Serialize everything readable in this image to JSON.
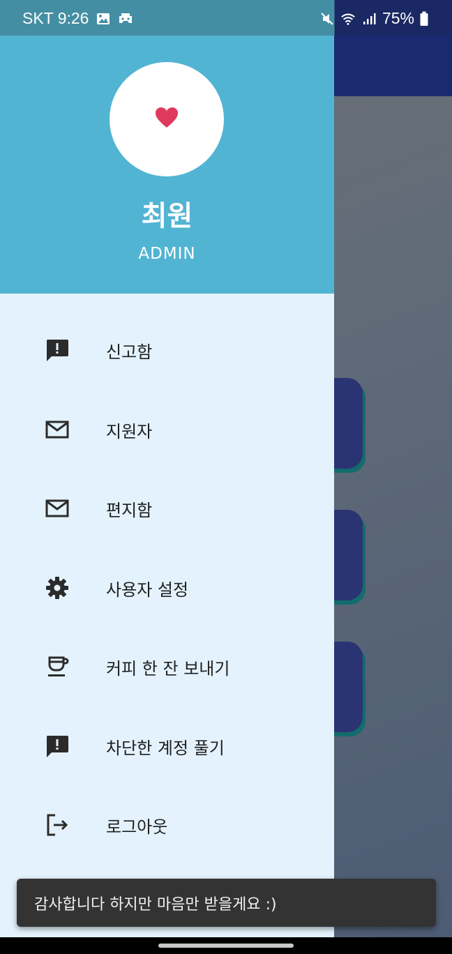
{
  "status_bar": {
    "carrier_time": "SKT 9:26",
    "left_icons": [
      "image-icon",
      "game-controller-icon"
    ],
    "right_icons": [
      "mute-icon",
      "wifi-icon",
      "signal-icon"
    ],
    "battery": "75%"
  },
  "drawer": {
    "header": {
      "avatar_icon": "heart-icon",
      "name": "최원",
      "role": "ADMIN"
    },
    "items": [
      {
        "label": "신고함",
        "icon": "report-icon"
      },
      {
        "label": "지원자",
        "icon": "mail-icon"
      },
      {
        "label": "편지함",
        "icon": "mail-icon"
      },
      {
        "label": "사용자 설정",
        "icon": "gear-icon"
      },
      {
        "label": "커피 한 잔 보내기",
        "icon": "coffee-icon"
      },
      {
        "label": "차단한 계정 풀기",
        "icon": "report-icon"
      },
      {
        "label": "로그아웃",
        "icon": "logout-icon"
      }
    ]
  },
  "snackbar": {
    "message": "감사합니다 하지만 마음만 받을게요 :)"
  },
  "colors": {
    "header": "#52b4d3",
    "drawer_bg": "#e3f2fc",
    "heart": "#e0395e",
    "app_bar": "#1b2a70",
    "snackbar_bg": "#333333"
  }
}
